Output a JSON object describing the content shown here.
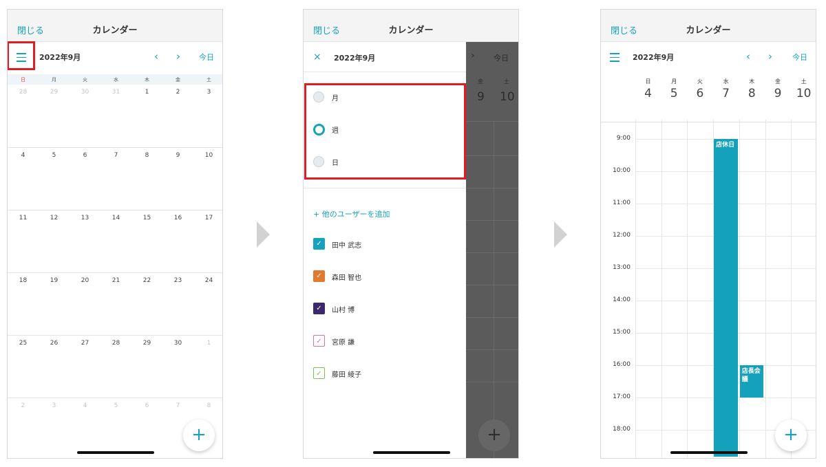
{
  "common": {
    "close_label": "閉じる",
    "title": "カレンダー",
    "month_label": "2022年9月",
    "prev_icon": "‹",
    "next_icon": "›",
    "today_label": "今日",
    "fab_label": "+"
  },
  "month_view": {
    "weekdays": [
      "日",
      "月",
      "火",
      "水",
      "木",
      "金",
      "土"
    ],
    "weeks": [
      [
        "28",
        "29",
        "30",
        "31",
        "1",
        "2",
        "3"
      ],
      [
        "4",
        "5",
        "6",
        "7",
        "8",
        "9",
        "10"
      ],
      [
        "11",
        "12",
        "13",
        "14",
        "15",
        "16",
        "17"
      ],
      [
        "18",
        "19",
        "20",
        "21",
        "22",
        "23",
        "24"
      ],
      [
        "25",
        "26",
        "27",
        "28",
        "29",
        "30",
        "1"
      ],
      [
        "2",
        "3",
        "4",
        "5",
        "6",
        "7",
        "8"
      ]
    ]
  },
  "drawer": {
    "close_icon": "×",
    "view_options": [
      {
        "label": "月",
        "selected": false
      },
      {
        "label": "週",
        "selected": true
      },
      {
        "label": "日",
        "selected": false
      }
    ],
    "add_user_label": "+ 他のユーザーを追加",
    "users": [
      {
        "name": "田中 武志",
        "checked": true,
        "color": "#17a2bb"
      },
      {
        "name": "森田 智也",
        "checked": true,
        "color": "#e07a2e"
      },
      {
        "name": "山村 博",
        "checked": true,
        "color": "#3b2a6b"
      },
      {
        "name": "宮原 謙",
        "checked": false,
        "color": "#e26aa8"
      },
      {
        "name": "藤田 綾子",
        "checked": false,
        "color": "#7cc04f"
      }
    ],
    "overlay": {
      "weekdays": [
        "金",
        "土"
      ],
      "dates": [
        "9",
        "10"
      ]
    }
  },
  "week_view": {
    "weekdays": [
      "日",
      "月",
      "火",
      "水",
      "木",
      "金",
      "土"
    ],
    "dates": [
      "4",
      "5",
      "6",
      "7",
      "8",
      "9",
      "10"
    ],
    "times": [
      "9:00",
      "10:00",
      "11:00",
      "12:00",
      "13:00",
      "14:00",
      "15:00",
      "16:00",
      "17:00",
      "18:00"
    ],
    "events": [
      {
        "title": "店休日",
        "day_index": 3,
        "start": "9:00",
        "end": "18:50"
      },
      {
        "title": "店長会議",
        "day_index": 4,
        "start": "16:00",
        "end": "17:00"
      }
    ]
  },
  "colors": {
    "accent": "#16a2bb",
    "highlight": "#e11b22",
    "event": "#14a1bb",
    "sunday": "#e83a3a"
  }
}
